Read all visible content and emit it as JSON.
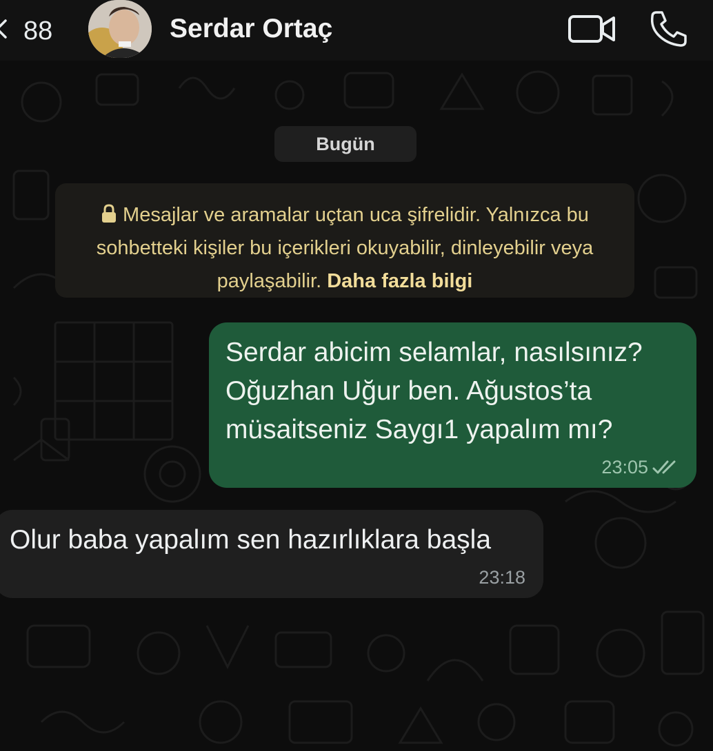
{
  "header": {
    "back_count": "88",
    "contact_name": "Serdar Ortaç",
    "icons": {
      "back": "chevron-left-icon",
      "video": "video-camera-icon",
      "phone": "phone-icon"
    }
  },
  "chat": {
    "date_divider": "Bugün",
    "encryption_notice": {
      "icon": "lock-icon",
      "text": "Mesajlar ve aramalar uçtan uca şifrelidir. Yalnızca bu sohbetteki kişiler bu içerikleri okuyabilir, dinleyebilir veya paylaşabilir.",
      "link": "Daha fazla bilgi"
    },
    "messages": [
      {
        "direction": "outgoing",
        "lines": [
          "Serdar abicim selamlar, nasılsınız?",
          "Oğuzhan Uğur ben. Ağustos’ta",
          "müsaitseniz Saygı1 yapalım mı?"
        ],
        "time": "23:05",
        "status": "read-double-check-icon"
      },
      {
        "direction": "incoming",
        "lines": [
          "Olur baba yapalım sen hazırlıklara başla"
        ],
        "time": "23:18"
      }
    ]
  },
  "colors": {
    "outgoing_bubble": "#1f5b3a",
    "incoming_bubble": "#1f1f1f",
    "encryption_text": "#e3d08e",
    "background": "#0b0b0b"
  }
}
